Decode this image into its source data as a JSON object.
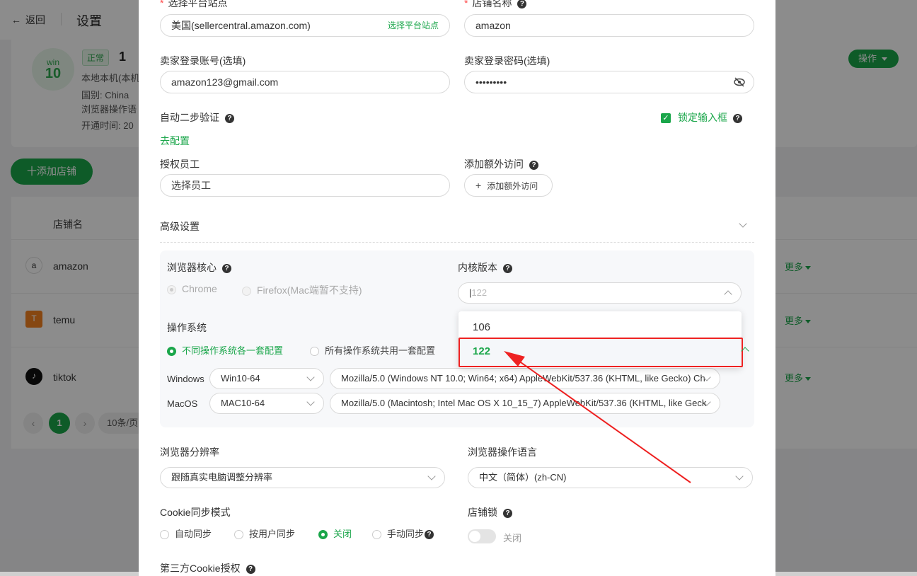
{
  "background": {
    "back_label": "返回",
    "page_title": "设置",
    "device": {
      "os": "win",
      "version": "10"
    },
    "status_tag": "正常",
    "shop_count": "1",
    "info_lines": [
      "本地本机(本机",
      "国别: China",
      "浏览器操作语",
      "开通时间: 20"
    ],
    "operate_button": "操作",
    "add_shop_button": "十添加店铺",
    "table_header_name": "店铺名",
    "rows": [
      {
        "name": "amazon",
        "icon": "a",
        "more": "更多"
      },
      {
        "name": "temu",
        "icon": "T",
        "more": "更多"
      },
      {
        "name": "tiktok",
        "icon": "♪",
        "more": "更多"
      }
    ],
    "pagination": {
      "current": "1",
      "page_size": "10条/页"
    }
  },
  "modal": {
    "platform_site_label": "选择平台站点",
    "platform_site_value": "美国(sellercentral.amazon.com)",
    "platform_site_link": "选择平台站点",
    "shop_name_label": "店铺名称",
    "shop_name_value": "amazon",
    "seller_account_label": "卖家登录账号(选填)",
    "seller_account_value": "amazon123@gmail.com",
    "seller_password_label": "卖家登录密码(选填)",
    "seller_password_value": "•••••••••",
    "two_step_label": "自动二步验证",
    "lock_input_label": "锁定输入框",
    "configure_link": "去配置",
    "authorize_staff_label": "授权员工",
    "authorize_staff_placeholder": "选择员工",
    "extra_access_label": "添加额外访问",
    "extra_access_button": "添加额外访问",
    "advanced_label": "高级设置",
    "browser_core_label": "浏览器核心",
    "core_chrome": "Chrome",
    "core_firefox": "Firefox(Mac端暂不支持)",
    "kernel_version_label": "内核版本",
    "kernel_version_value": "122",
    "kernel_options": [
      "106",
      "122"
    ],
    "os_label": "操作系统",
    "os_option_each": "不同操作系统各一套配置",
    "os_option_shared": "所有操作系统共用一套配置",
    "windows_label": "Windows",
    "windows_os": "Win10-64",
    "windows_ua": "Mozilla/5.0 (Windows NT 10.0; Win64; x64) AppleWebKit/537.36 (KHTML, like Gecko) Ch",
    "mac_label": "MacOS",
    "mac_os": "MAC10-64",
    "mac_ua": "Mozilla/5.0 (Macintosh; Intel Mac OS X 10_15_7) AppleWebKit/537.36 (KHTML, like Geck",
    "resolution_label": "浏览器分辨率",
    "resolution_value": "跟随真实电脑调整分辨率",
    "language_label": "浏览器操作语言",
    "language_value": "中文（简体）(zh-CN)",
    "cookie_sync_label": "Cookie同步模式",
    "cookie_options": [
      "自动同步",
      "按用户同步",
      "关闭",
      "手动同步"
    ],
    "shop_lock_label": "店铺锁",
    "shop_lock_state": "关闭",
    "third_party_cookie_label": "第三方Cookie授权"
  },
  "colors": {
    "accent": "#1aa64a",
    "highlight": "#ee2222"
  }
}
